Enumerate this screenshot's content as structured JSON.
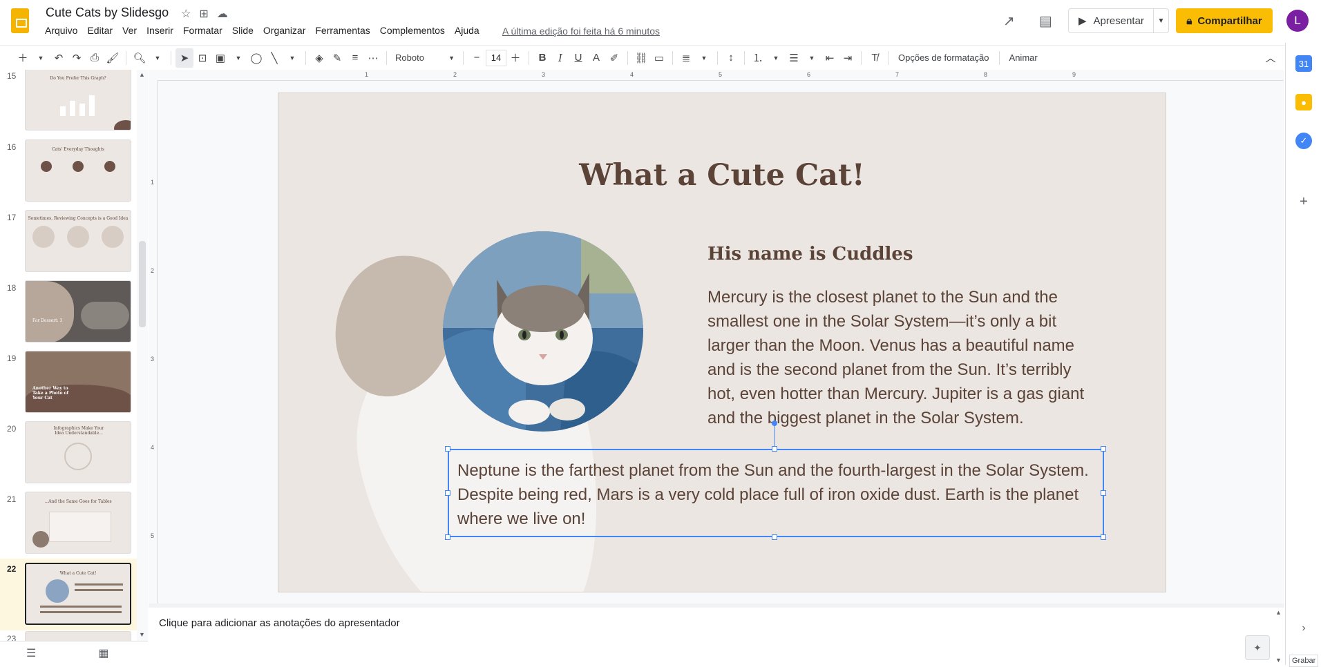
{
  "app": {
    "doc_title": "Cute Cats by Slidesgo",
    "last_edit": "A última edição foi feita há 6 minutos",
    "avatar_letter": "L",
    "present_label": "Apresentar",
    "share_label": "Compartilhar"
  },
  "menu": [
    "Arquivo",
    "Editar",
    "Ver",
    "Inserir",
    "Formatar",
    "Slide",
    "Organizar",
    "Ferramentas",
    "Complementos",
    "Ajuda"
  ],
  "toolbar": {
    "font": "Roboto",
    "font_size": "14",
    "format_options": "Opções de formatação",
    "animate": "Animar"
  },
  "filmstrip": [
    {
      "num": "15",
      "title": "Do You Prefer This Graph?"
    },
    {
      "num": "16",
      "title": "Cats' Everyday Thoughts"
    },
    {
      "num": "17",
      "title": "Sometimes, Reviewing Concepts is a Good Idea"
    },
    {
      "num": "18",
      "title": "For Dessert: 3"
    },
    {
      "num": "19",
      "title": "Another Way to Take a Photo of Your Cat"
    },
    {
      "num": "20",
      "title": "Infographics Make Your Idea Understandable..."
    },
    {
      "num": "21",
      "title": "...And the Same Goes for Tables"
    },
    {
      "num": "22",
      "title": "What a Cute Cat!"
    },
    {
      "num": "23",
      "title": ""
    }
  ],
  "slide": {
    "title": "What a Cute Cat!",
    "subtitle": "His name is Cuddles",
    "body": "Mercury is the closest planet to the Sun and the smallest one in the Solar System—it’s only a bit larger than the Moon. Venus has a beautiful name and is the second planet from the Sun. It’s terribly hot, even hotter than Mercury. Jupiter is a gas giant and the biggest planet in the Solar System.",
    "body2": "Neptune is the farthest planet from the Sun and the fourth-largest in the Solar System. Despite being red, Mars is a very cold place full of iron oxide dust. Earth is the planet where we live on!"
  },
  "notes": {
    "placeholder": "Clique para adicionar as anotações do apresentador"
  },
  "ruler": {
    "h": [
      "1",
      "2",
      "3",
      "4",
      "5",
      "6",
      "7",
      "8",
      "9"
    ],
    "v": [
      "1",
      "2",
      "3",
      "4",
      "5"
    ]
  },
  "tooltip": "Grabar",
  "colors": {
    "brand_yellow": "#fbbc04",
    "slide_bg": "#ebe6e2",
    "slide_text": "#5b4338",
    "selection": "#4285f4"
  }
}
